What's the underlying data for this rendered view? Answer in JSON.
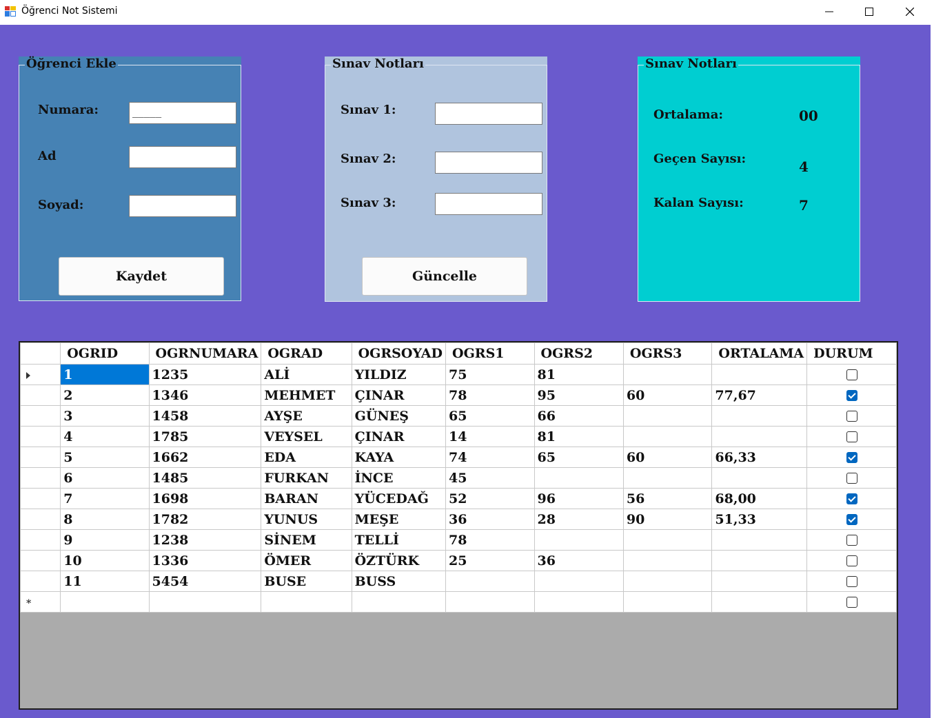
{
  "window": {
    "title": "Öğrenci Not Sistemi"
  },
  "ogrenci_ekle": {
    "title": "Öğrenci Ekle",
    "numara_label": "Numara:",
    "numara_value": "_____",
    "ad_label": "Ad",
    "ad_value": "",
    "soyad_label": "Soyad:",
    "soyad_value": "",
    "kaydet_label": "Kaydet"
  },
  "sinav_notlari": {
    "title": "Sınav Notları",
    "sinav1_label": "Sınav 1:",
    "sinav1_value": "",
    "sinav2_label": "Sınav 2:",
    "sinav2_value": "",
    "sinav3_label": "Sınav 3:",
    "sinav3_value": "",
    "guncelle_label": "Güncelle"
  },
  "istatistik": {
    "title": "Sınav Notları",
    "ortalama_label": "Ortalama:",
    "ortalama_value": "00",
    "gecen_label": "Geçen Sayısı:",
    "gecen_value": "4",
    "kalan_label": "Kalan Sayısı:",
    "kalan_value": "7"
  },
  "grid": {
    "columns": [
      "OGRID",
      "OGRNUMARA",
      "OGRAD",
      "OGRSOYAD",
      "OGRS1",
      "OGRS2",
      "OGRS3",
      "ORTALAMA",
      "DURUM"
    ],
    "rows": [
      [
        "1",
        "1235",
        "ALİ",
        "YILDIZ",
        "75",
        "81",
        "",
        "",
        false
      ],
      [
        "2",
        "1346",
        "MEHMET",
        "ÇINAR",
        "78",
        "95",
        "60",
        "77,67",
        true
      ],
      [
        "3",
        "1458",
        "AYŞE",
        "GÜNEŞ",
        "65",
        "66",
        "",
        "",
        false
      ],
      [
        "4",
        "1785",
        "VEYSEL",
        "ÇINAR",
        "14",
        "81",
        "",
        "",
        false
      ],
      [
        "5",
        "1662",
        "EDA",
        "KAYA",
        "74",
        "65",
        "60",
        "66,33",
        true
      ],
      [
        "6",
        "1485",
        "FURKAN",
        "İNCE",
        "45",
        "",
        "",
        "",
        false
      ],
      [
        "7",
        "1698",
        "BARAN",
        "YÜCEDAĞ",
        "52",
        "96",
        "56",
        "68,00",
        true
      ],
      [
        "8",
        "1782",
        "YUNUS",
        "MEŞE",
        "36",
        "28",
        "90",
        "51,33",
        true
      ],
      [
        "9",
        "1238",
        "SİNEM",
        "TELLİ",
        "78",
        "",
        "",
        "",
        false
      ],
      [
        "10",
        "1336",
        "ÖMER",
        "ÖZTÜRK",
        "25",
        "36",
        "",
        "",
        false
      ],
      [
        "11",
        "5454",
        "BUSE",
        "BUSS",
        "",
        "",
        "",
        "",
        false
      ]
    ],
    "new_row_marker": "*"
  },
  "colors": {
    "background": "#6a5acd",
    "panel_ekle": "#4682b4",
    "panel_sinav": "#b0c4de",
    "panel_istatistik": "#00ced1",
    "grid_empty": "#ababab",
    "selection": "#0078d7"
  }
}
